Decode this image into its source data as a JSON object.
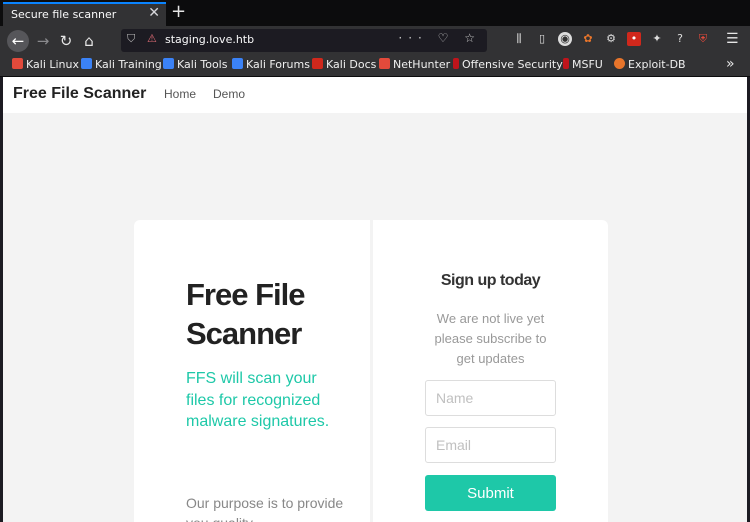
{
  "browser": {
    "tab_title": "Secure file scanner",
    "tab_close": "✕",
    "new_tab": "+",
    "url": "staging.love.htb",
    "url_actions": "··· ♡ ☆",
    "bookmarks": [
      {
        "label": "Kali Linux",
        "color": "#e24a3b"
      },
      {
        "label": "Kali Training",
        "color": "#3b82f6"
      },
      {
        "label": "Kali Tools",
        "color": "#3b82f6"
      },
      {
        "label": "Kali Forums",
        "color": "#3b82f6"
      },
      {
        "label": "Kali Docs",
        "color": "#d0281c"
      },
      {
        "label": "NetHunter",
        "color": "#e24a3b"
      },
      {
        "label": "Offensive Security",
        "color": "#c0141b"
      },
      {
        "label": "MSFU",
        "color": "#c0141b"
      },
      {
        "label": "Exploit-DB",
        "color": "#e8752b"
      }
    ]
  },
  "site": {
    "brand": "Free File Scanner",
    "nav": [
      "Home",
      "Demo"
    ],
    "hero_title": "Free File Scanner",
    "hero_subtitle": "FFS will scan your files for recognized malware signatures.",
    "hero_body": "Our purpose is to provide you quality",
    "signup": {
      "title": "Sign up today",
      "text": "We are not live yet please subscribe to get updates",
      "name_placeholder": "Name",
      "email_placeholder": "Email",
      "submit_label": "Submit"
    },
    "accent_color": "#1ec8a8"
  }
}
